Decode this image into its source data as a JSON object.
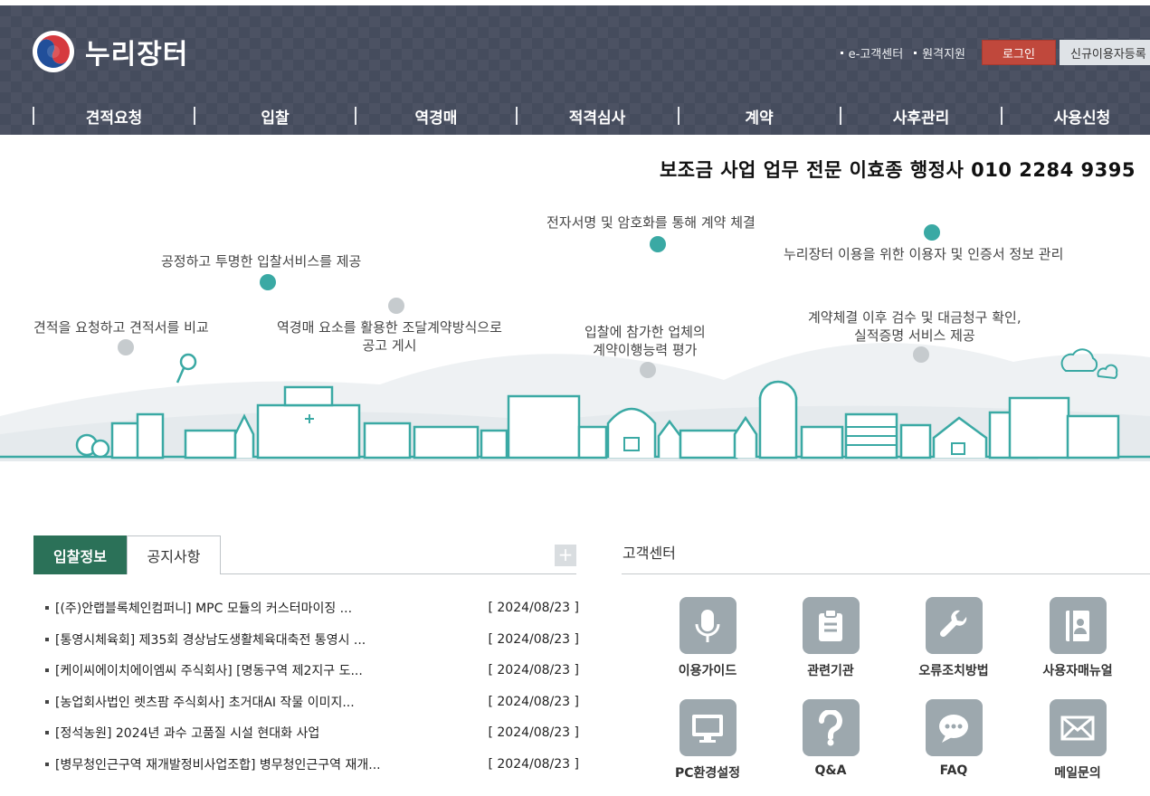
{
  "header": {
    "logo_text": "누리장터",
    "util_links": [
      "e-고객센터",
      "원격지원"
    ],
    "login_label": "로그인",
    "register_label": "신규이용자등록"
  },
  "gnb": [
    "견적요청",
    "입찰",
    "역경매",
    "적격심사",
    "계약",
    "사후관리",
    "사용신청"
  ],
  "ad_banner": "보조금 사업 업무 전문 이효종 행정사 010 2284 9395",
  "hero": {
    "captions": [
      "전자서명 및 암호화를 통해 계약 체결",
      "공정하고 투명한 입찰서비스를 제공",
      "누리장터 이용을 위한 이용자 및 인증서 정보 관리",
      "견적을 요청하고 견적서를 비교",
      "역경매 요소를 활용한 조달계약방식으로\n공고 게시",
      "입찰에 참가한 업체의\n계약이행능력 평가",
      "계약체결 이후 검수 및 대금청구 확인,\n실적증명 서비스 제공"
    ]
  },
  "bid": {
    "tabs": [
      "입찰정보",
      "공지사항"
    ],
    "more_label": "+",
    "items": [
      {
        "title": "[(주)안랩블록체인컴퍼니] MPC 모듈의 커스터마이징 ...",
        "date": "[ 2024/08/23 ]"
      },
      {
        "title": "[통영시체육회] 제35회 경상남도생활체육대축전 통영시 ...",
        "date": "[ 2024/08/23 ]"
      },
      {
        "title": "[케이씨에이치에이엠씨 주식회사] [명동구역 제2지구 도...",
        "date": "[ 2024/08/23 ]"
      },
      {
        "title": "[농업회사법인 렛츠팜 주식회사] 초거대AI 작물 이미지...",
        "date": "[ 2024/08/23 ]"
      },
      {
        "title": "[정석농원] 2024년 과수 고품질 시설 현대화 사업",
        "date": "[ 2024/08/23 ]"
      },
      {
        "title": "[병무청인근구역 재개발정비사업조합] 병무청인근구역 재개...",
        "date": "[ 2024/08/23 ]"
      }
    ]
  },
  "customer_center": {
    "title": "고객센터",
    "items": [
      {
        "label": "이용가이드",
        "icon": "microphone-icon"
      },
      {
        "label": "관련기관",
        "icon": "clipboard-icon"
      },
      {
        "label": "오류조치방법",
        "icon": "wrench-icon"
      },
      {
        "label": "사용자매뉴얼",
        "icon": "manual-book-icon"
      },
      {
        "label": "PC환경설정",
        "icon": "monitor-icon"
      },
      {
        "label": "Q&A",
        "icon": "question-icon"
      },
      {
        "label": "FAQ",
        "icon": "chat-bubble-icon"
      },
      {
        "label": "메일문의",
        "icon": "mail-icon"
      }
    ]
  },
  "colors": {
    "header_bg": "#454c5d",
    "login_button": "#c0483c",
    "tab_active": "#2b7158",
    "hero_teal": "#3aa9a4",
    "icon_tile": "#9da8ae"
  }
}
